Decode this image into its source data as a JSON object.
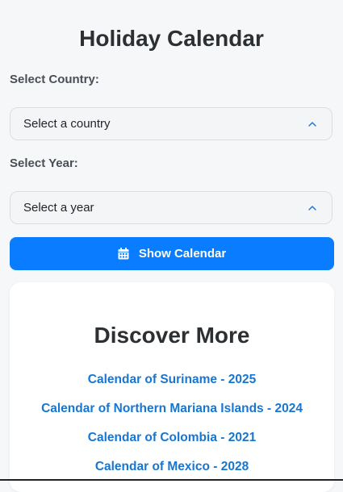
{
  "page": {
    "title": "Holiday Calendar"
  },
  "form": {
    "country_label": "Select Country:",
    "country_value": "Select a country",
    "year_label": "Select Year:",
    "year_value": "Select a year",
    "chevron_icon": "chevron-up-icon",
    "submit_label": "Show Calendar",
    "submit_icon": "calendar-icon"
  },
  "discover": {
    "title": "Discover More",
    "links": [
      {
        "label": "Calendar of Suriname - 2025"
      },
      {
        "label": "Calendar of Northern Mariana Islands - 2024"
      },
      {
        "label": "Calendar of Colombia - 2021"
      },
      {
        "label": "Calendar of Mexico - 2028"
      }
    ]
  },
  "colors": {
    "accent": "#0a7cff",
    "link": "#1676d2",
    "background": "#f6f7f9",
    "heading": "#2d3033"
  }
}
